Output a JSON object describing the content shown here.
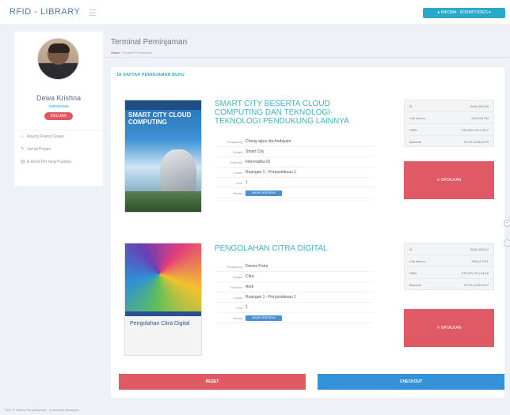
{
  "header": {
    "brand": "RFID - LIBRARY",
    "menu_icon": "bars-icon",
    "user_button": "● NIKOMA · DORMITORIES ▾"
  },
  "sidebar": {
    "profile_name": "Dewa Krishna",
    "profile_role": "mahasiswa",
    "logout_label": "KELUAR",
    "menu": [
      {
        "icon": "home-icon",
        "label": "Ruang Ruang Depan"
      },
      {
        "icon": "pencil-icon",
        "label": "Jurnal Pinjam"
      },
      {
        "icon": "book-icon",
        "label": "E-Book Per tang Pustaka"
      }
    ]
  },
  "page": {
    "title": "Terminal Peminjaman",
    "breadcrumb_home": "Home",
    "breadcrumb_current": "/ Terminal Peminjaman"
  },
  "panel": {
    "title": "DI DAFTAR PEMINJAMAN BUKU",
    "labels": {
      "author": "Pengarang",
      "subject": "Subjek",
      "publisher": "Penerbit",
      "location": "Lokasi",
      "stock": "Stok",
      "status": "Status"
    },
    "meta_labels": {
      "id": "ID",
      "call_number": "Call Nomor",
      "isbn": "ISBN",
      "barcode": "Barcode"
    },
    "cancel_label": "✕ BATALKAN",
    "available_label": "MASIH TERSEDIA",
    "books": [
      {
        "title": "SMART CITY BESERTA CLOUD COMPUTING DAN TEKNOLOGI-TEKNOLOGI PENDUKUNG LAINNYA",
        "cover_title": "SMART CITY CLOUD COMPUTING",
        "author": "Cheng agus Ida Andayani",
        "subject": "Smart City",
        "publisher": "Informatika ID",
        "location": "Ruangan 1 - Perpustakaan 1",
        "stock": "1",
        "meta": {
          "id": "BUK-000178",
          "call_number": "004.678 SM",
          "isbn": "978-602-1514-35-7",
          "barcode": "B-ITS-1234-0179"
        }
      },
      {
        "title": "PENGOLAHAN CITRA DIGITAL",
        "cover_title": "Pengolahan Citra Digital",
        "author": "Darma Putra",
        "subject": "Citra",
        "publisher": "Andi",
        "location": "Ruangan 1 - Perpustakaan 1",
        "stock": "1",
        "meta": {
          "id": "BUK-000212",
          "call_number": "006.42 PUT",
          "isbn": "978-979-29-1443-6",
          "barcode": "B-ITS-1234-0212"
        }
      }
    ],
    "reset_label": "RESET",
    "checkout_label": "CHECKOUT"
  },
  "side_controls": [
    "+",
    "−"
  ],
  "footer": "2017 © Sistem Perpustakaan - Universitas Brawijaya"
}
